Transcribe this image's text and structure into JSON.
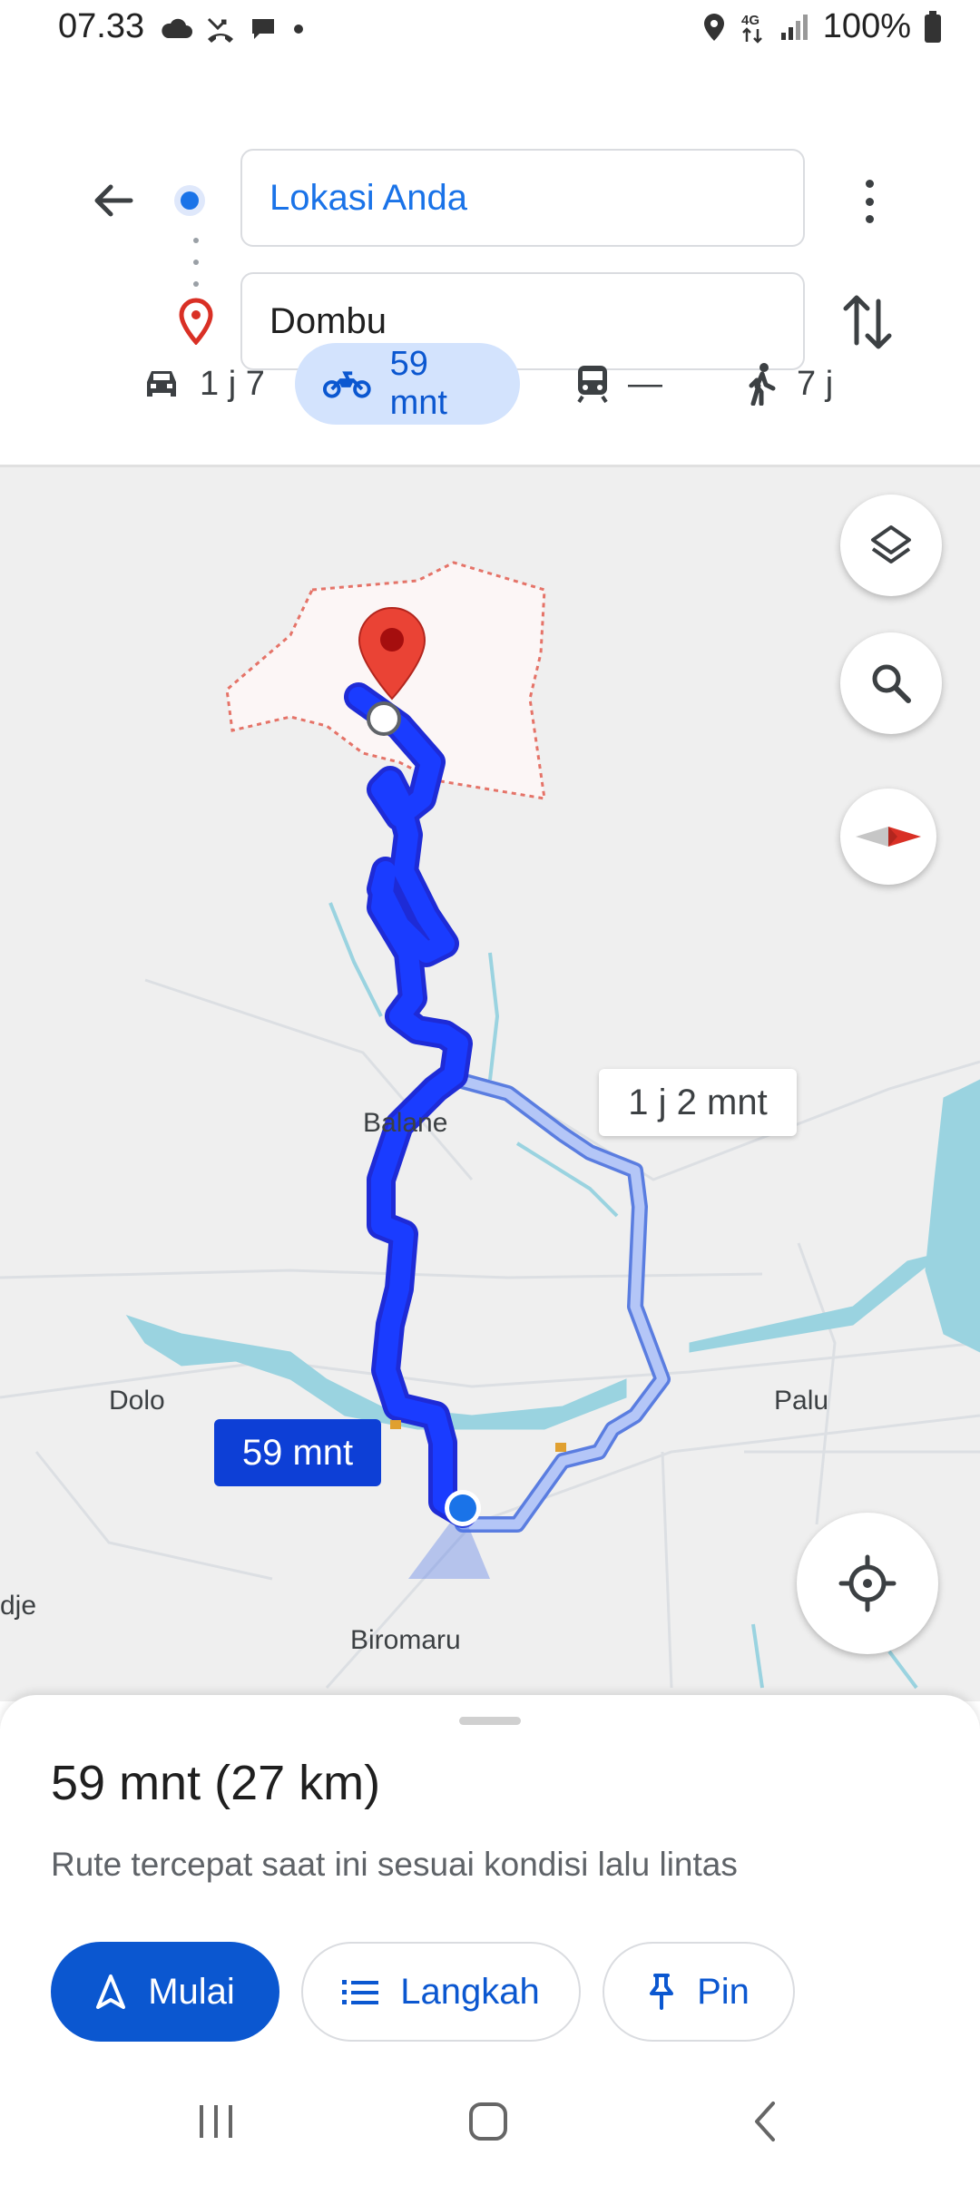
{
  "status_bar": {
    "time": "07.33",
    "battery": "100%",
    "network": "4G"
  },
  "directions": {
    "origin": "Lokasi Anda",
    "destination": "Dombu"
  },
  "modes": [
    {
      "name": "car",
      "label": "1 j 7",
      "selected": false
    },
    {
      "name": "motorcycle",
      "label": "59 mnt",
      "selected": true
    },
    {
      "name": "transit",
      "label": "—",
      "selected": false
    },
    {
      "name": "walk",
      "label": "7 j",
      "selected": false
    }
  ],
  "map": {
    "places": {
      "balane": "Balane",
      "dolo": "Dolo",
      "palu": "Palu",
      "biromaru": "Biromaru",
      "edge": "dje"
    },
    "route_main_label": "59 mnt",
    "route_alt_label": "1 j 2 mnt"
  },
  "sheet": {
    "summary": "59 mnt (27 km)",
    "description": "Rute tercepat saat ini sesuai kondisi lalu lintas",
    "start_label": "Mulai",
    "steps_label": "Langkah",
    "pin_label": "Pin"
  },
  "colors": {
    "accent": "#0b57d0",
    "route": "#1a3cff",
    "route_alt": "#9fb4f5",
    "pin": "#ea4335",
    "water": "#9ad3e0"
  }
}
